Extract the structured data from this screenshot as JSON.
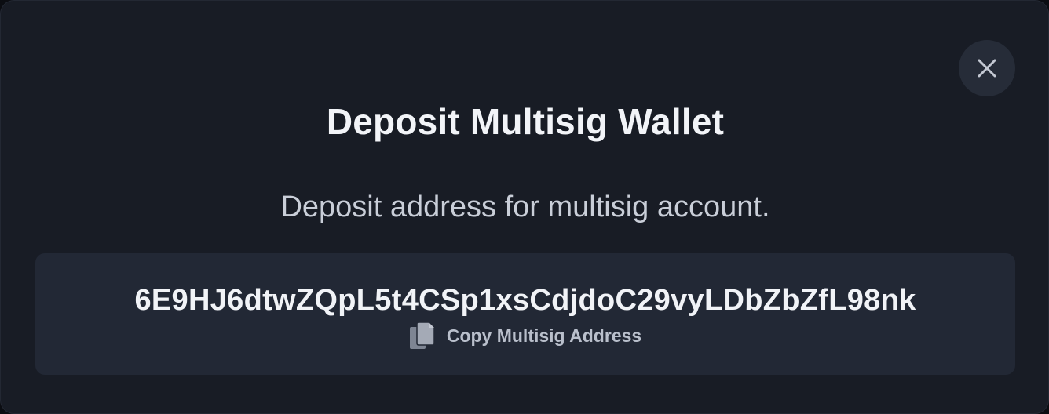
{
  "modal": {
    "title": "Deposit Multisig Wallet",
    "subtitle": "Deposit address for multisig account.",
    "address": "6E9HJ6dtwZQpL5t4CSp1xsCdjdoC29vyLDbZbZfL98nk",
    "copy_label": "Copy Multisig Address",
    "close_icon": "close-icon",
    "copy_icon": "copy-icon"
  },
  "colors": {
    "modal_bg": "#181c25",
    "box_bg": "#222835",
    "close_bg": "#262c38",
    "text_primary": "#f2f4f8",
    "text_secondary": "#c9ced8",
    "icon_muted": "#9aa1ad"
  }
}
